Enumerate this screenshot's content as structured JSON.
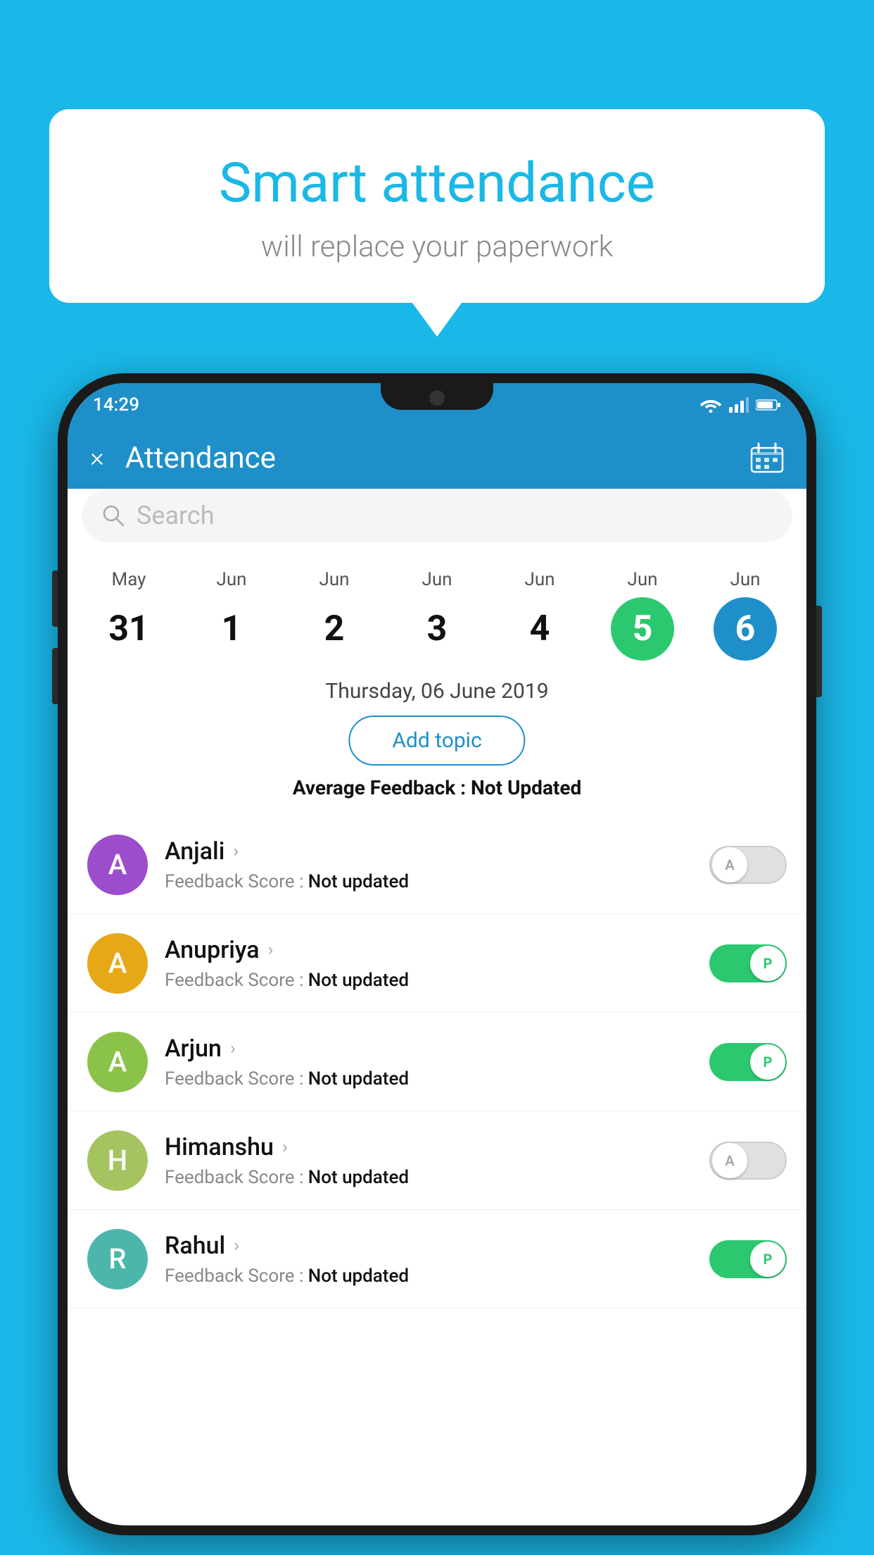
{
  "background_color": "#1ab8e8",
  "speech_bubble": {
    "title": "Smart attendance",
    "subtitle": "will replace your paperwork"
  },
  "status_bar": {
    "time": "14:29",
    "icons": [
      "wifi",
      "signal",
      "battery"
    ]
  },
  "app_header": {
    "title": "Attendance",
    "close_label": "×",
    "calendar_icon": "📅"
  },
  "search": {
    "placeholder": "Search"
  },
  "calendar": {
    "days": [
      {
        "month": "May",
        "date": "31",
        "style": "normal"
      },
      {
        "month": "Jun",
        "date": "1",
        "style": "normal"
      },
      {
        "month": "Jun",
        "date": "2",
        "style": "normal"
      },
      {
        "month": "Jun",
        "date": "3",
        "style": "normal"
      },
      {
        "month": "Jun",
        "date": "4",
        "style": "normal"
      },
      {
        "month": "Jun",
        "date": "5",
        "style": "active-green"
      },
      {
        "month": "Jun",
        "date": "6",
        "style": "active-blue"
      }
    ]
  },
  "selected_date": "Thursday, 06 June 2019",
  "add_topic_label": "Add topic",
  "avg_feedback": {
    "label": "Average Feedback : ",
    "value": "Not Updated"
  },
  "students": [
    {
      "name": "Anjali",
      "avatar_letter": "A",
      "avatar_color": "#9c4dcc",
      "feedback_label": "Feedback Score : ",
      "feedback_value": "Not updated",
      "toggle": "off",
      "toggle_letter": "A"
    },
    {
      "name": "Anupriya",
      "avatar_letter": "A",
      "avatar_color": "#e6a817",
      "feedback_label": "Feedback Score : ",
      "feedback_value": "Not updated",
      "toggle": "on",
      "toggle_letter": "P"
    },
    {
      "name": "Arjun",
      "avatar_letter": "A",
      "avatar_color": "#8bc34a",
      "feedback_label": "Feedback Score : ",
      "feedback_value": "Not updated",
      "toggle": "on",
      "toggle_letter": "P"
    },
    {
      "name": "Himanshu",
      "avatar_letter": "H",
      "avatar_color": "#a5c461",
      "feedback_label": "Feedback Score : ",
      "feedback_value": "Not updated",
      "toggle": "off",
      "toggle_letter": "A"
    },
    {
      "name": "Rahul",
      "avatar_letter": "R",
      "avatar_color": "#4db6ac",
      "feedback_label": "Feedback Score : ",
      "feedback_value": "Not updated",
      "toggle": "on",
      "toggle_letter": "P"
    }
  ]
}
